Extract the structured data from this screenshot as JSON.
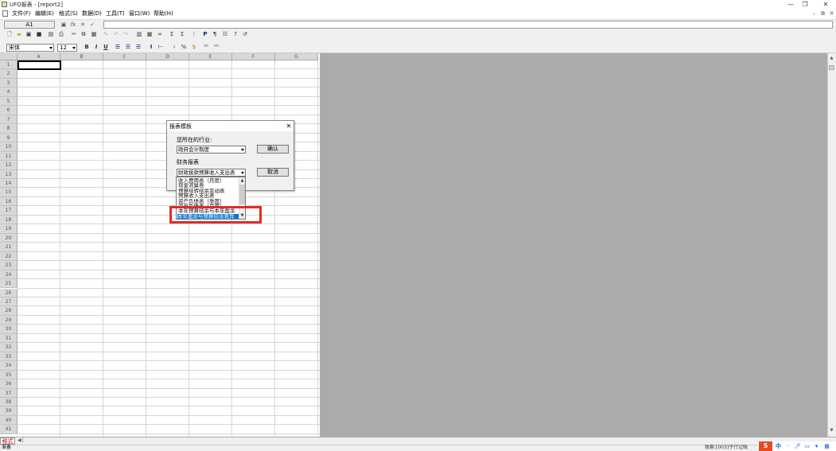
{
  "window": {
    "title": "UFO报表 - [report2]",
    "controls": [
      "—",
      "❐",
      "✕"
    ]
  },
  "menu": {
    "items": [
      "文件(F)",
      "编辑(E)",
      "格式(S)",
      "数据(D)",
      "工具(T)",
      "窗口(W)",
      "帮助(H)"
    ],
    "mdi_controls": [
      "–",
      "⧉",
      "✕"
    ]
  },
  "formula_bar": {
    "cell_ref": "A1",
    "fx_symbols": [
      "▣",
      "fx",
      "✕",
      "✓"
    ],
    "value": ""
  },
  "toolbar1": {
    "icons": [
      "new-icon",
      "open-icon",
      "save-icon",
      "save-all-icon",
      "print-preview-icon",
      "print-icon",
      "cut-icon",
      "copy-icon",
      "paste-icon",
      "format-painter-icon",
      "undo-icon",
      "redo-icon",
      "insert-row-icon",
      "insert-col-icon",
      "binoculars-icon",
      "sum-icon",
      "formula-icon",
      "function-icon",
      "p-icon",
      "page-icon",
      "chart-icon",
      "help-icon",
      "back-icon"
    ]
  },
  "toolbar2": {
    "font": "宋体",
    "size": "12",
    "format_buttons": [
      "B",
      "I",
      "U"
    ],
    "align_icons": [
      "align-left-icon",
      "align-center-icon",
      "align-right-icon",
      "vertical-align-icon",
      "horizontal-fit-icon",
      "arrow-icon",
      "percent-icon",
      "currency-icon",
      "number-format-icon",
      "decimal-icon"
    ]
  },
  "sheet": {
    "columns": [
      "A",
      "B",
      "C",
      "D",
      "E",
      "F",
      "G"
    ],
    "rows": [
      "1",
      "2",
      "3",
      "4",
      "5",
      "6",
      "7",
      "8",
      "9",
      "10",
      "11",
      "12",
      "13",
      "14",
      "15",
      "16",
      "17",
      "18",
      "19",
      "20",
      "21",
      "22",
      "23",
      "24",
      "25",
      "26",
      "27",
      "28",
      "29",
      "30",
      "31",
      "32",
      "33",
      "34",
      "35",
      "36",
      "37",
      "38",
      "39",
      "40",
      "41"
    ],
    "active_cell": "A1"
  },
  "dialog": {
    "title": "报表模板",
    "industry_label": "您所在的行业:",
    "industry_value": "政府会计制度",
    "report_label": "财务报表",
    "report_value": "财政拨款预算收入支出表",
    "ok": "确认",
    "cancel": "取消",
    "report_list": [
      "收入费用表（月度）",
      "现金流量表",
      "预算结转结余变动表",
      "预算收入支出表",
      "资产负债表（季度）",
      "资产负债表（月度）",
      "本年预算结余与本年盈余",
      "本年盈余与预算结余差异"
    ],
    "selected_index": 7
  },
  "sheet_tab": "格式",
  "status": {
    "left": "准备",
    "right": "账套:[003]子行记账"
  },
  "ime": {
    "logo": "S",
    "label": "中"
  },
  "colors": {
    "highlight": "#e32a2a",
    "gray_area": "#ababab",
    "selection": "#0078d7",
    "sheet_tab_text": "#cc0000"
  }
}
